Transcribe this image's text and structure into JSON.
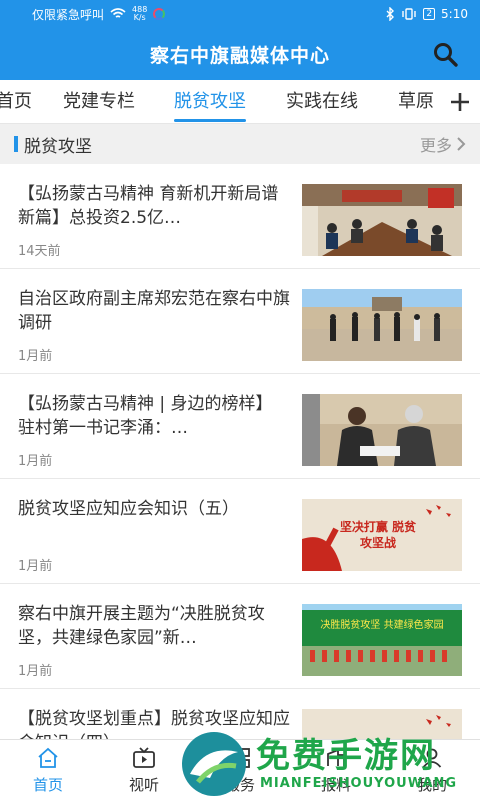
{
  "status_bar": {
    "carrier": "仅限紧急呼叫",
    "net_speed_value": "488",
    "net_speed_unit": "K/s",
    "battery": "2",
    "time": "5:10"
  },
  "header": {
    "title": "察右中旗融媒体中心"
  },
  "tabs": [
    {
      "label": "首页"
    },
    {
      "label": "党建专栏"
    },
    {
      "label": "脱贫攻坚"
    },
    {
      "label": "实践在线"
    },
    {
      "label": "草原"
    }
  ],
  "active_tab": "脱贫攻坚",
  "section": {
    "title": "脱贫攻坚",
    "more": "更多"
  },
  "articles": [
    {
      "title": "【弘扬蒙古马精神 育新机开新局谱新篇】总投资2.5亿…",
      "time": "14天前",
      "image": "meeting-photo"
    },
    {
      "title": "自治区政府副主席郑宏范在察右中旗调研",
      "time": "1月前",
      "image": "inspection-photo"
    },
    {
      "title": "【弘扬蒙古马精神 | 身边的榜样】 驻村第一书记李涌：…",
      "time": "1月前",
      "image": "visit-photo"
    },
    {
      "title": "脱贫攻坚应知应会知识（五）",
      "time": "1月前",
      "image": "poster-image"
    },
    {
      "title": "察右中旗开展主题为“决胜脱贫攻坚，共建绿色家园”新…",
      "time": "1月前",
      "image": "banner-photo"
    },
    {
      "title": "【脱贫攻坚划重点】脱贫攻坚应知应会知识（四）",
      "time": "",
      "image": "poster-image"
    }
  ],
  "poster_text": "坚决打赢 脱贫攻坚战",
  "banner_text": "决胜脱贫攻坚 共建绿色家园",
  "bottom_nav": [
    {
      "label": "首页",
      "icon": "home-icon"
    },
    {
      "label": "视听",
      "icon": "video-icon"
    },
    {
      "label": "服务",
      "icon": "grid-icon"
    },
    {
      "label": "报料",
      "icon": "report-icon"
    },
    {
      "label": "我的",
      "icon": "user-icon"
    }
  ],
  "watermark": {
    "text": "免费手游网",
    "sub": "MIANFEISHOUYOUWANG"
  },
  "colors": {
    "accent": "#2293e8",
    "poster_red": "#c8281e",
    "watermark_green": "#1fa64a"
  }
}
